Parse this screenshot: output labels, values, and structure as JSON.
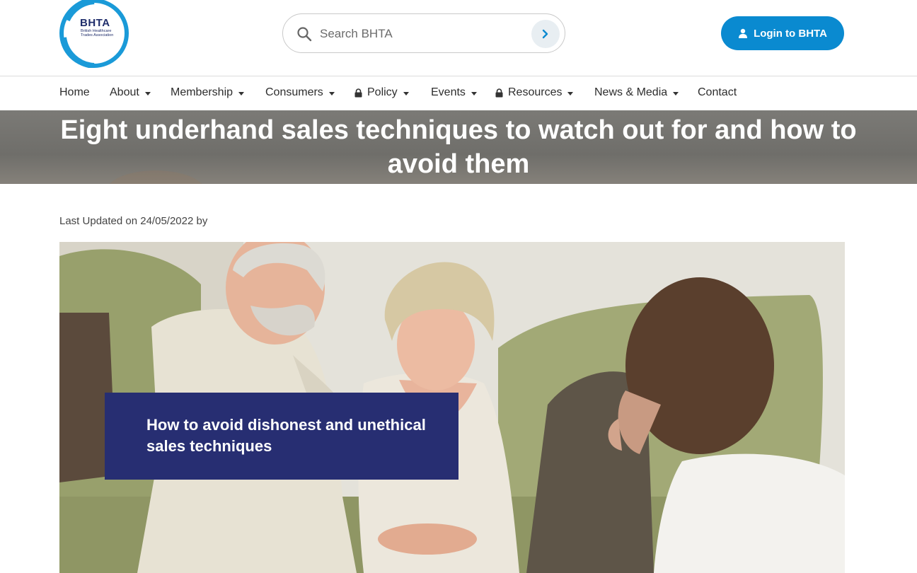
{
  "logo": {
    "name": "BHTA",
    "subtitle": "British Healthcare Trades Association"
  },
  "search": {
    "placeholder": "Search BHTA"
  },
  "login": {
    "label": "Login to BHTA"
  },
  "nav": [
    {
      "label": "Home",
      "dropdown": false,
      "locked": false
    },
    {
      "label": "About",
      "dropdown": true,
      "locked": false
    },
    {
      "label": "Membership",
      "dropdown": true,
      "locked": false
    },
    {
      "label": "Consumers",
      "dropdown": true,
      "locked": false
    },
    {
      "label": "Policy",
      "dropdown": true,
      "locked": true
    },
    {
      "label": "Events",
      "dropdown": true,
      "locked": false
    },
    {
      "label": "Resources",
      "dropdown": true,
      "locked": true
    },
    {
      "label": "News & Media",
      "dropdown": true,
      "locked": false
    },
    {
      "label": "Contact",
      "dropdown": false,
      "locked": false
    }
  ],
  "page": {
    "title": "Eight underhand sales techniques to watch out for and how to avoid them",
    "updated": "Last Updated on 24/05/2022 by"
  },
  "hero": {
    "caption": "How to avoid dishonest and unethical sales techniques"
  },
  "colors": {
    "brand_blue": "#0a8ad0",
    "navy": "#272e72",
    "banner_grey": "#74736f"
  },
  "icons": [
    "search-icon",
    "chevron-right-icon",
    "user-icon",
    "lock-icon",
    "caret-down-icon"
  ]
}
